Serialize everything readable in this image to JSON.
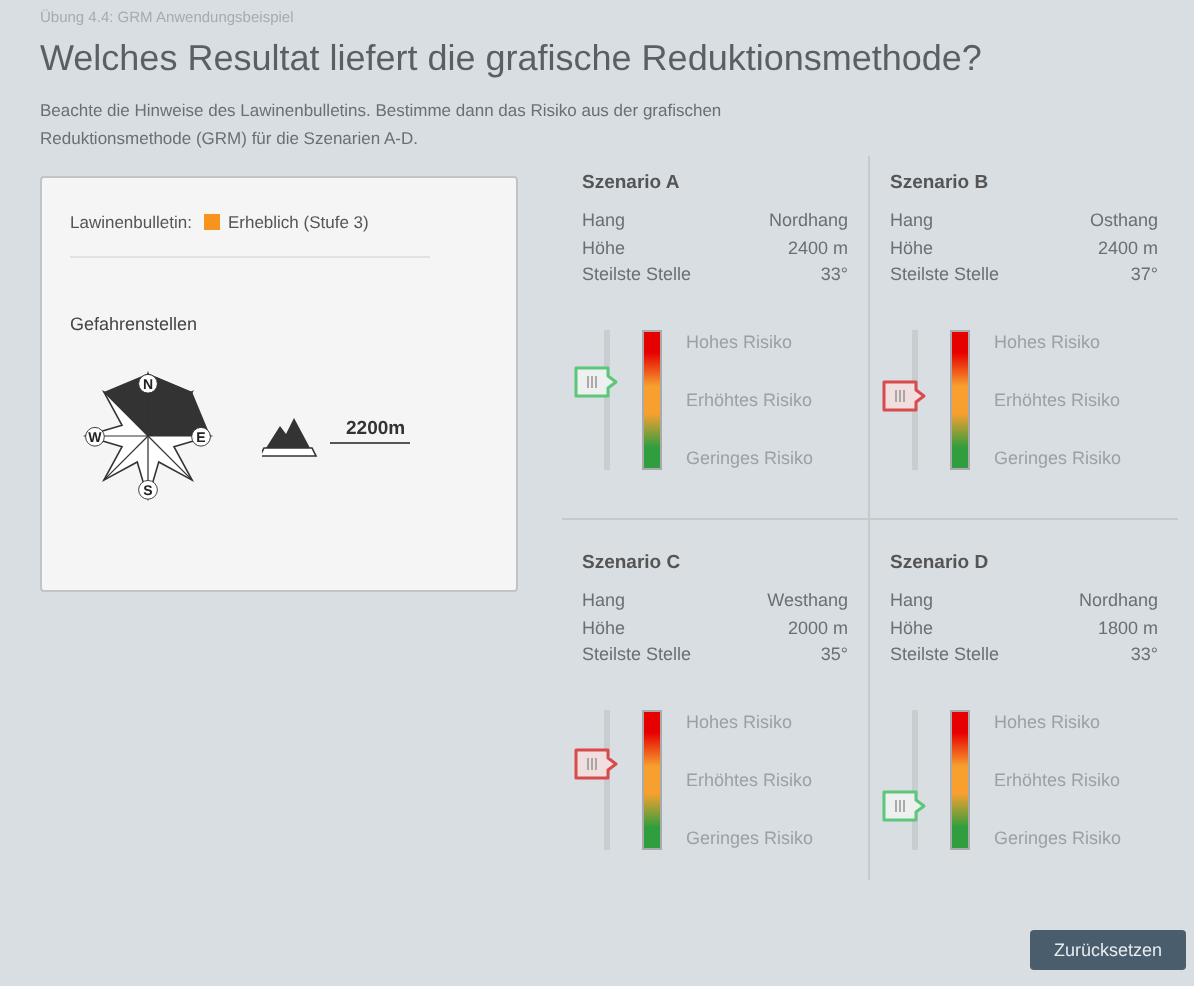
{
  "breadcrumb": "Übung 4.4: GRM Anwendungsbeispiel",
  "title": "Welches Resultat liefert die grafische Reduktionsmethode?",
  "instructions": "Beachte die Hinweise des Lawinenbulletins. Bestimme dann das Risiko aus der grafischen Reduktionsmethode (GRM) für die Szenarien A-D.",
  "bulletin": {
    "label": "Lawinenbulletin:",
    "level_text": "Erheblich (Stufe 3)",
    "color": "#f7941d"
  },
  "hazard": {
    "heading": "Gefahrenstellen",
    "compass_labels": [
      "N",
      "E",
      "S",
      "W"
    ],
    "altitude": "2200m"
  },
  "scenarios": [
    {
      "title": "Szenario A",
      "facts": [
        {
          "label": "Hang",
          "value": "Nordhang"
        },
        {
          "label": "Höhe",
          "value": "2400 m"
        },
        {
          "label": "Steilste Stelle",
          "value": "33°"
        }
      ],
      "level": 0.61,
      "correct": true,
      "risk_labels": [
        "Hohes Risiko",
        "Erhöhtes Risiko",
        "Geringes Risiko"
      ]
    },
    {
      "title": "Szenario B",
      "facts": [
        {
          "label": "Hang",
          "value": "Osthang"
        },
        {
          "label": "Höhe",
          "value": "2400 m"
        },
        {
          "label": "Steilste Stelle",
          "value": "37°"
        }
      ],
      "level": 0.51,
      "correct": false,
      "risk_labels": [
        "Hohes Risiko",
        "Erhöhtes Risiko",
        "Geringes Risiko"
      ]
    },
    {
      "title": "Szenario C",
      "facts": [
        {
          "label": "Hang",
          "value": "Westhang"
        },
        {
          "label": "Höhe",
          "value": "2000 m"
        },
        {
          "label": "Steilste Stelle",
          "value": "35°"
        }
      ],
      "level": 0.6,
      "correct": false,
      "risk_labels": [
        "Hohes Risiko",
        "Erhöhtes Risiko",
        "Geringes Risiko"
      ]
    },
    {
      "title": "Szenario D",
      "facts": [
        {
          "label": "Hang",
          "value": "Nordhang"
        },
        {
          "label": "Höhe",
          "value": "1800 m"
        },
        {
          "label": "Steilste Stelle",
          "value": "33°"
        }
      ],
      "level": 0.3,
      "correct": true,
      "risk_labels": [
        "Hohes Risiko",
        "Erhöhtes Risiko",
        "Geringes Risiko"
      ]
    }
  ],
  "reset_button": "Zurücksetzen"
}
